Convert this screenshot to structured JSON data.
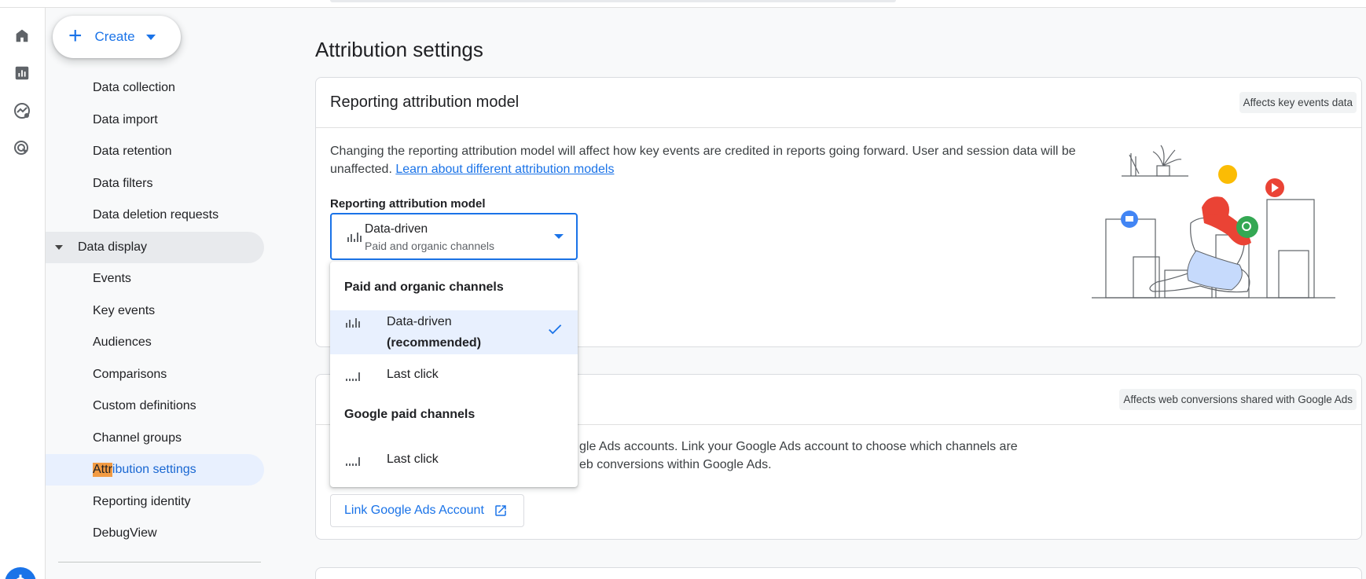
{
  "create": {
    "label": "Create"
  },
  "sidebar": {
    "items": [
      {
        "label": "Data collection"
      },
      {
        "label": "Data import"
      },
      {
        "label": "Data retention"
      },
      {
        "label": "Data filters"
      },
      {
        "label": "Data deletion requests"
      },
      {
        "label": "Data display"
      },
      {
        "label": "Events"
      },
      {
        "label": "Key events"
      },
      {
        "label": "Audiences"
      },
      {
        "label": "Comparisons"
      },
      {
        "label": "Custom definitions"
      },
      {
        "label": "Channel groups"
      },
      {
        "label": "Attribution settings",
        "highlight": "Attr",
        "rest": "ibution settings"
      },
      {
        "label": "Reporting identity"
      },
      {
        "label": "DebugView"
      }
    ]
  },
  "page": {
    "title": "Attribution settings"
  },
  "reporting_card": {
    "title": "Reporting attribution model",
    "chip": "Affects key events data",
    "description": "Changing the reporting attribution model will affect how key events are credited in reports going forward. User and session data will be unaffected.",
    "learn_link": "Learn about different attribution models",
    "field_label": "Reporting attribution model",
    "select": {
      "title": "Data-driven",
      "subtitle": "Paid and organic channels"
    }
  },
  "menu": {
    "group1": "Paid and organic channels",
    "group2": "Google paid channels",
    "option1_line1": "Data-driven",
    "option1_line2": "(recommended)",
    "option2": "Last click",
    "option3": "Last click"
  },
  "ads_card": {
    "chip": "Affects web conversions shared with Google Ads",
    "line1": "gle Ads accounts. Link your Google Ads account to choose which channels are",
    "line2": "eb conversions within Google Ads.",
    "link_button": "Link Google Ads Account"
  },
  "colors": {
    "accent": "#1a73e8",
    "highlight": "#f29b43",
    "active_bg": "#e8f0fe"
  }
}
